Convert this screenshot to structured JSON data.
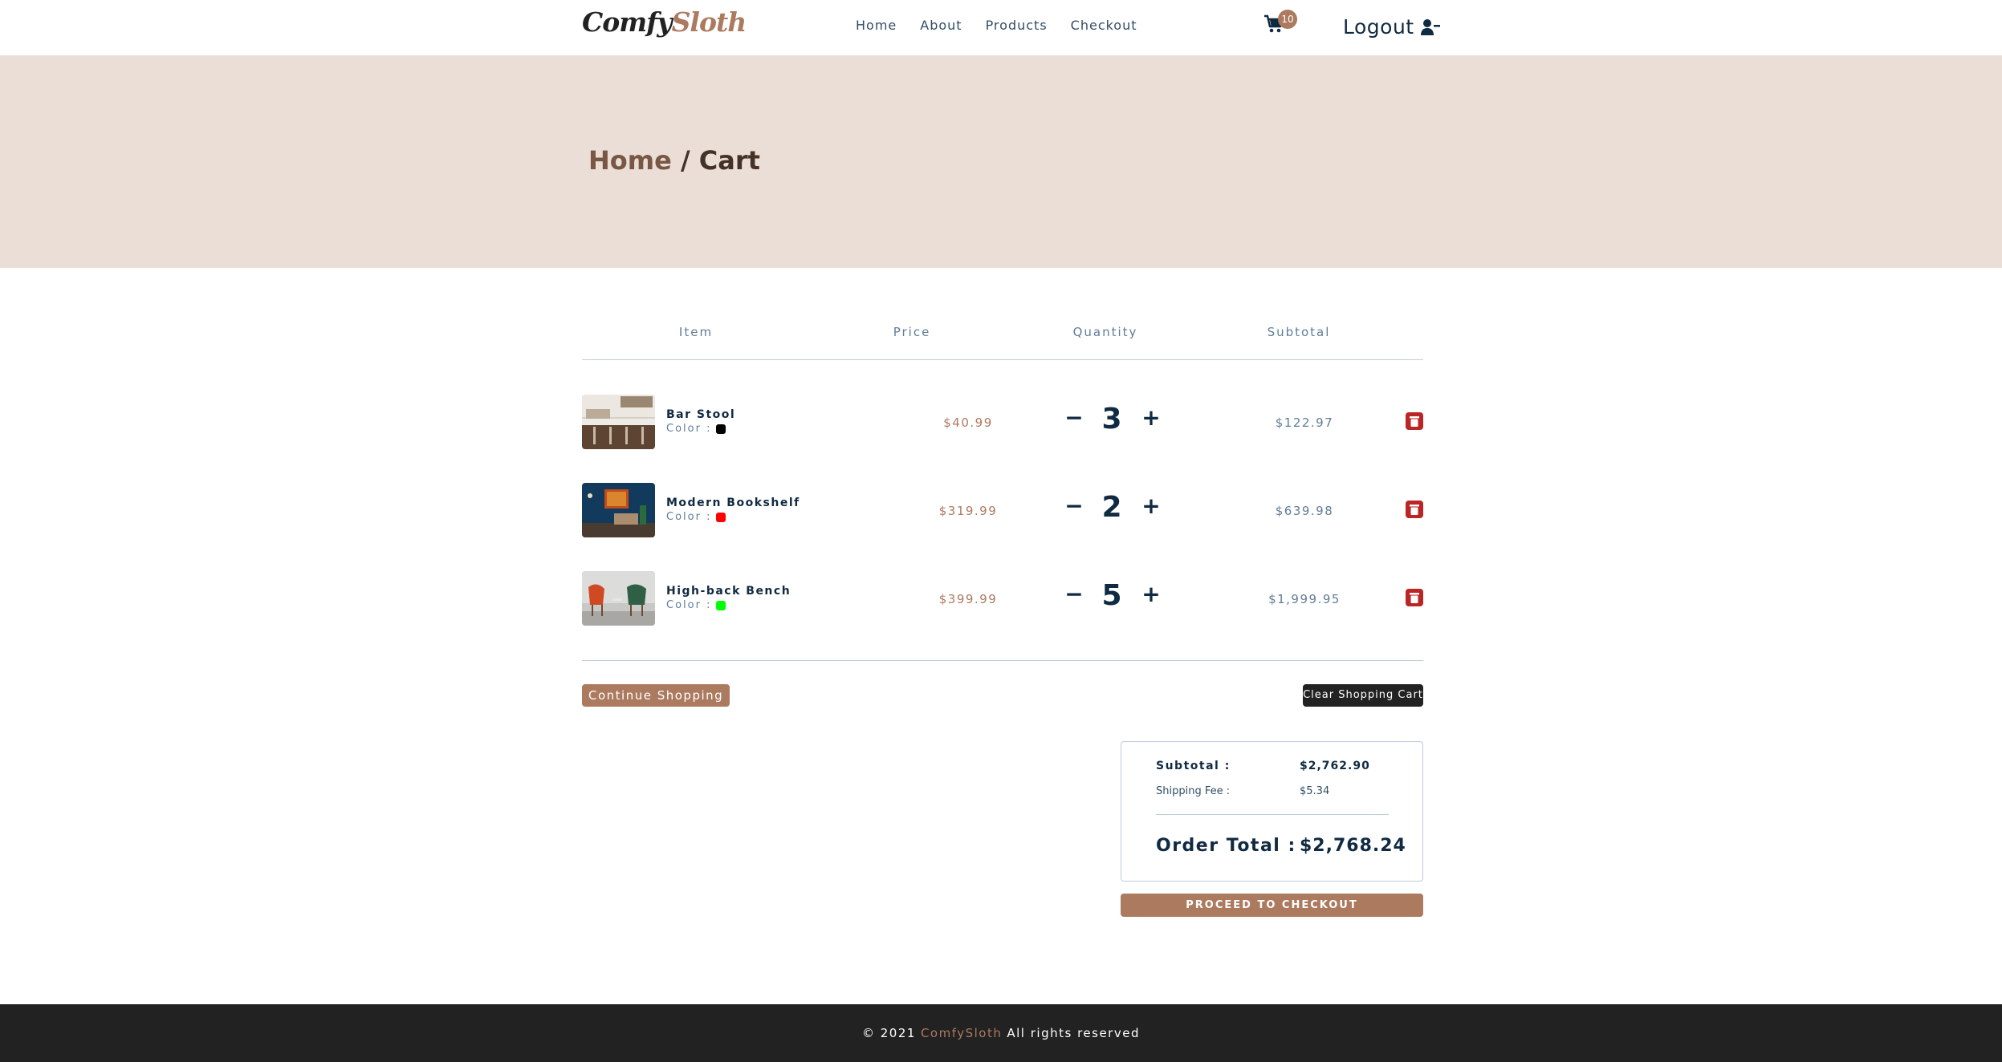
{
  "navbar": {
    "logo_part1": "Comfy",
    "logo_part2": "Sloth",
    "links": [
      "Home",
      "About",
      "Products",
      "Checkout"
    ],
    "cart_count": "10",
    "logout_label": "Logout"
  },
  "breadcrumb": {
    "home": "Home",
    "separator": " / ",
    "current": "Cart"
  },
  "table": {
    "headers": [
      "Item",
      "Price",
      "Quantity",
      "Subtotal"
    ],
    "rows": [
      {
        "name": "Bar Stool",
        "color_label": "Color :",
        "color": "#000000",
        "price": "$40.99",
        "quantity": "3",
        "subtotal": "$122.97",
        "image": "bar-stool-image"
      },
      {
        "name": "Modern Bookshelf",
        "color_label": "Color :",
        "color": "#ff0000",
        "price": "$319.99",
        "quantity": "2",
        "subtotal": "$639.98",
        "image": "modern-bookshelf-image"
      },
      {
        "name": "High-back Bench",
        "color_label": "Color :",
        "color": "#00ff00",
        "price": "$399.99",
        "quantity": "5",
        "subtotal": "$1,999.95",
        "image": "high-back-bench-image"
      }
    ]
  },
  "buttons": {
    "continue_shopping": "Continue Shopping",
    "clear_cart": "Clear Shopping Cart",
    "checkout": "PROCEED TO CHECKOUT"
  },
  "totals": {
    "subtotal_label": "Subtotal :",
    "subtotal_value": "$2,762.90",
    "shipping_label": "Shipping Fee :",
    "shipping_value": "$5.34",
    "order_total_label": "Order Total :",
    "order_total_value": "$2,768.24"
  },
  "footer": {
    "prefix": "© 2021",
    "brand": "ComfySloth",
    "suffix": "All rights reserved"
  },
  "colors": {
    "accent": "#ab7a5f",
    "hero_bg": "#eaded7",
    "dark": "#222222",
    "delete": "#bb2525"
  }
}
